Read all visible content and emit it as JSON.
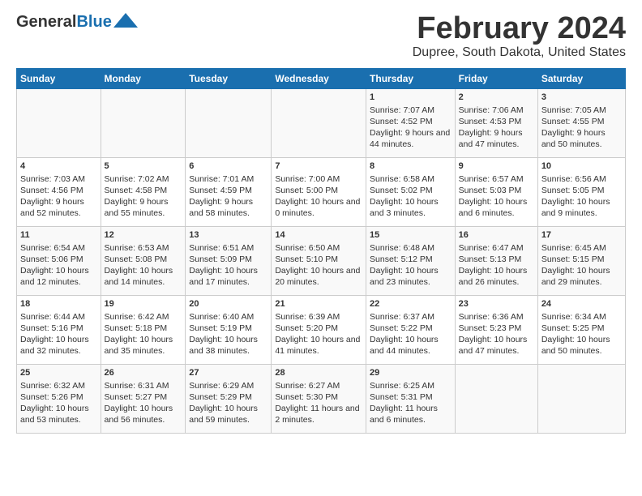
{
  "header": {
    "logo_general": "General",
    "logo_blue": "Blue",
    "month": "February 2024",
    "location": "Dupree, South Dakota, United States"
  },
  "days_of_week": [
    "Sunday",
    "Monday",
    "Tuesday",
    "Wednesday",
    "Thursday",
    "Friday",
    "Saturday"
  ],
  "weeks": [
    [
      {
        "day": "",
        "content": ""
      },
      {
        "day": "",
        "content": ""
      },
      {
        "day": "",
        "content": ""
      },
      {
        "day": "",
        "content": ""
      },
      {
        "day": "1",
        "content": "Sunrise: 7:07 AM\nSunset: 4:52 PM\nDaylight: 9 hours and 44 minutes."
      },
      {
        "day": "2",
        "content": "Sunrise: 7:06 AM\nSunset: 4:53 PM\nDaylight: 9 hours and 47 minutes."
      },
      {
        "day": "3",
        "content": "Sunrise: 7:05 AM\nSunset: 4:55 PM\nDaylight: 9 hours and 50 minutes."
      }
    ],
    [
      {
        "day": "4",
        "content": "Sunrise: 7:03 AM\nSunset: 4:56 PM\nDaylight: 9 hours and 52 minutes."
      },
      {
        "day": "5",
        "content": "Sunrise: 7:02 AM\nSunset: 4:58 PM\nDaylight: 9 hours and 55 minutes."
      },
      {
        "day": "6",
        "content": "Sunrise: 7:01 AM\nSunset: 4:59 PM\nDaylight: 9 hours and 58 minutes."
      },
      {
        "day": "7",
        "content": "Sunrise: 7:00 AM\nSunset: 5:00 PM\nDaylight: 10 hours and 0 minutes."
      },
      {
        "day": "8",
        "content": "Sunrise: 6:58 AM\nSunset: 5:02 PM\nDaylight: 10 hours and 3 minutes."
      },
      {
        "day": "9",
        "content": "Sunrise: 6:57 AM\nSunset: 5:03 PM\nDaylight: 10 hours and 6 minutes."
      },
      {
        "day": "10",
        "content": "Sunrise: 6:56 AM\nSunset: 5:05 PM\nDaylight: 10 hours and 9 minutes."
      }
    ],
    [
      {
        "day": "11",
        "content": "Sunrise: 6:54 AM\nSunset: 5:06 PM\nDaylight: 10 hours and 12 minutes."
      },
      {
        "day": "12",
        "content": "Sunrise: 6:53 AM\nSunset: 5:08 PM\nDaylight: 10 hours and 14 minutes."
      },
      {
        "day": "13",
        "content": "Sunrise: 6:51 AM\nSunset: 5:09 PM\nDaylight: 10 hours and 17 minutes."
      },
      {
        "day": "14",
        "content": "Sunrise: 6:50 AM\nSunset: 5:10 PM\nDaylight: 10 hours and 20 minutes."
      },
      {
        "day": "15",
        "content": "Sunrise: 6:48 AM\nSunset: 5:12 PM\nDaylight: 10 hours and 23 minutes."
      },
      {
        "day": "16",
        "content": "Sunrise: 6:47 AM\nSunset: 5:13 PM\nDaylight: 10 hours and 26 minutes."
      },
      {
        "day": "17",
        "content": "Sunrise: 6:45 AM\nSunset: 5:15 PM\nDaylight: 10 hours and 29 minutes."
      }
    ],
    [
      {
        "day": "18",
        "content": "Sunrise: 6:44 AM\nSunset: 5:16 PM\nDaylight: 10 hours and 32 minutes."
      },
      {
        "day": "19",
        "content": "Sunrise: 6:42 AM\nSunset: 5:18 PM\nDaylight: 10 hours and 35 minutes."
      },
      {
        "day": "20",
        "content": "Sunrise: 6:40 AM\nSunset: 5:19 PM\nDaylight: 10 hours and 38 minutes."
      },
      {
        "day": "21",
        "content": "Sunrise: 6:39 AM\nSunset: 5:20 PM\nDaylight: 10 hours and 41 minutes."
      },
      {
        "day": "22",
        "content": "Sunrise: 6:37 AM\nSunset: 5:22 PM\nDaylight: 10 hours and 44 minutes."
      },
      {
        "day": "23",
        "content": "Sunrise: 6:36 AM\nSunset: 5:23 PM\nDaylight: 10 hours and 47 minutes."
      },
      {
        "day": "24",
        "content": "Sunrise: 6:34 AM\nSunset: 5:25 PM\nDaylight: 10 hours and 50 minutes."
      }
    ],
    [
      {
        "day": "25",
        "content": "Sunrise: 6:32 AM\nSunset: 5:26 PM\nDaylight: 10 hours and 53 minutes."
      },
      {
        "day": "26",
        "content": "Sunrise: 6:31 AM\nSunset: 5:27 PM\nDaylight: 10 hours and 56 minutes."
      },
      {
        "day": "27",
        "content": "Sunrise: 6:29 AM\nSunset: 5:29 PM\nDaylight: 10 hours and 59 minutes."
      },
      {
        "day": "28",
        "content": "Sunrise: 6:27 AM\nSunset: 5:30 PM\nDaylight: 11 hours and 2 minutes."
      },
      {
        "day": "29",
        "content": "Sunrise: 6:25 AM\nSunset: 5:31 PM\nDaylight: 11 hours and 6 minutes."
      },
      {
        "day": "",
        "content": ""
      },
      {
        "day": "",
        "content": ""
      }
    ]
  ]
}
